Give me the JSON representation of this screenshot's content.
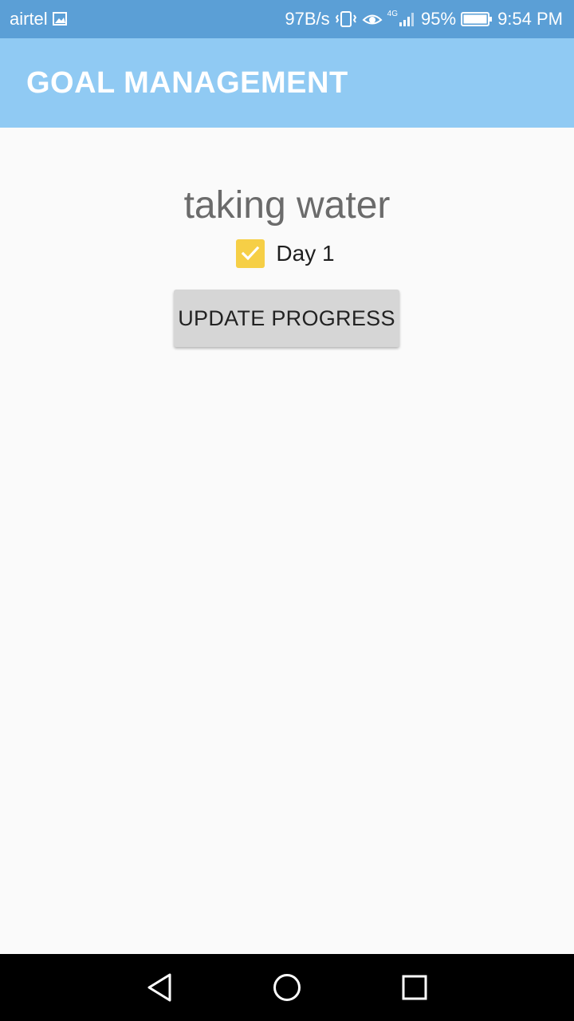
{
  "status_bar": {
    "carrier": "airtel",
    "net_speed": "97B/s",
    "network_type": "4G",
    "battery": "95%",
    "time": "9:54 PM",
    "icons": [
      "gallery-icon",
      "vibrate-icon",
      "eye-icon",
      "signal-icon",
      "battery-icon"
    ]
  },
  "app_bar": {
    "title": "GOAL MANAGEMENT",
    "color": "#90caf3"
  },
  "goal": {
    "title": "taking water",
    "checkbox": {
      "label": "Day 1",
      "checked": true,
      "color": "#f6cf46"
    },
    "button_label": "UPDATE PROGRESS"
  },
  "nav_bar": {
    "icons": [
      "back-icon",
      "home-icon",
      "recents-icon"
    ]
  }
}
